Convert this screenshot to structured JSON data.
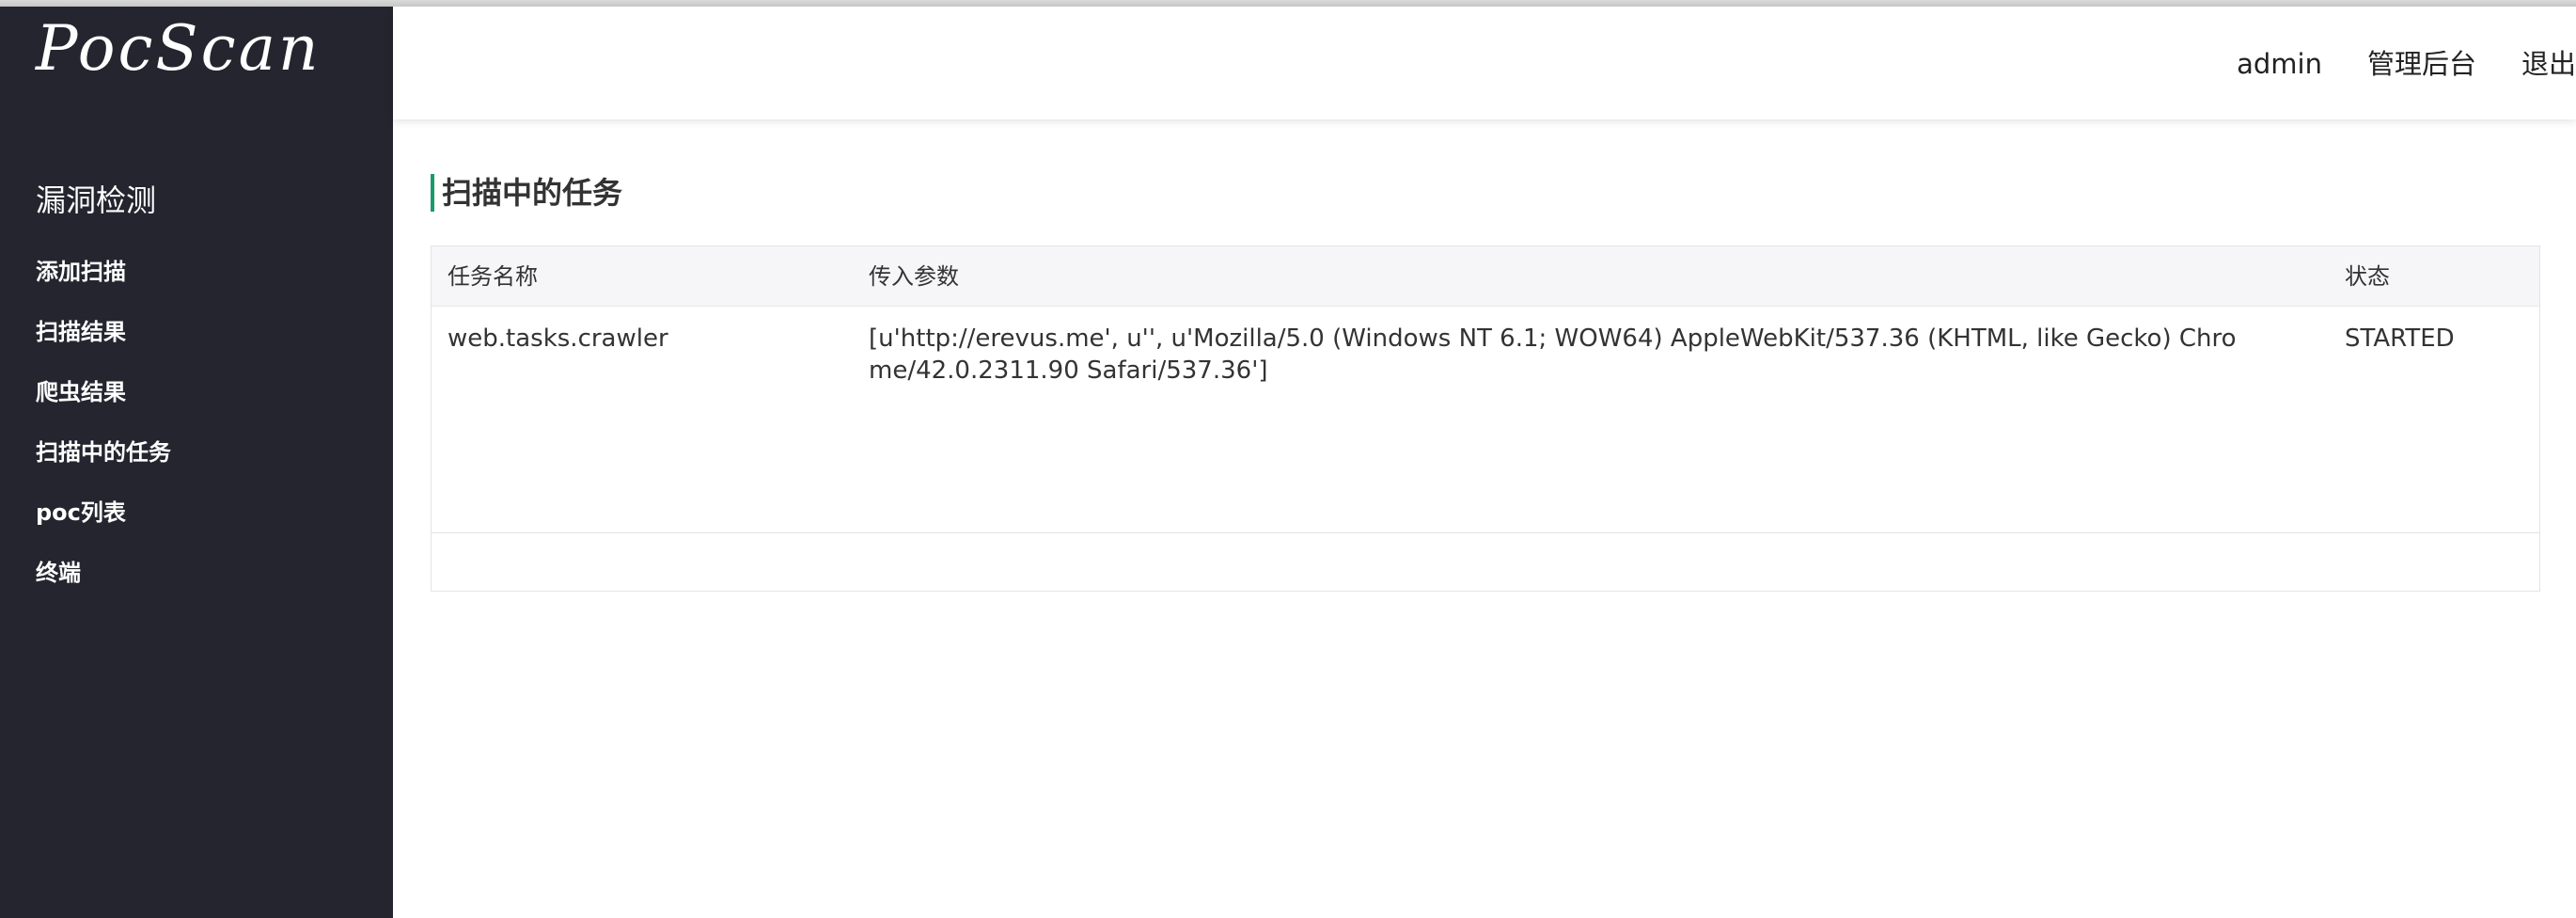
{
  "app": {
    "logo_text": "PocScan"
  },
  "sidebar": {
    "heading": "漏洞检测",
    "items": [
      {
        "label": "添加扫描"
      },
      {
        "label": "扫描结果"
      },
      {
        "label": "爬虫结果"
      },
      {
        "label": "扫描中的任务"
      },
      {
        "label": "poc列表"
      },
      {
        "label": "终端"
      }
    ]
  },
  "header": {
    "user": "admin",
    "admin_link": "管理后台",
    "logout_link": "退出"
  },
  "main": {
    "title": "扫描中的任务",
    "table": {
      "columns": [
        "任务名称",
        "传入参数",
        "状态"
      ],
      "rows": [
        {
          "name": "web.tasks.crawler",
          "args": "[u'http://erevus.me', u'', u'Mozilla/5.0 (Windows NT 6.1; WOW64) AppleWebKit/537.36 (KHTML, like Gecko) Chrome/42.0.2311.90 Safari/537.36']",
          "status": "STARTED"
        }
      ]
    }
  },
  "colors": {
    "sidebar_bg": "#24252f",
    "accent": "#1a9b6b",
    "table_header_bg": "#f6f6f8"
  }
}
